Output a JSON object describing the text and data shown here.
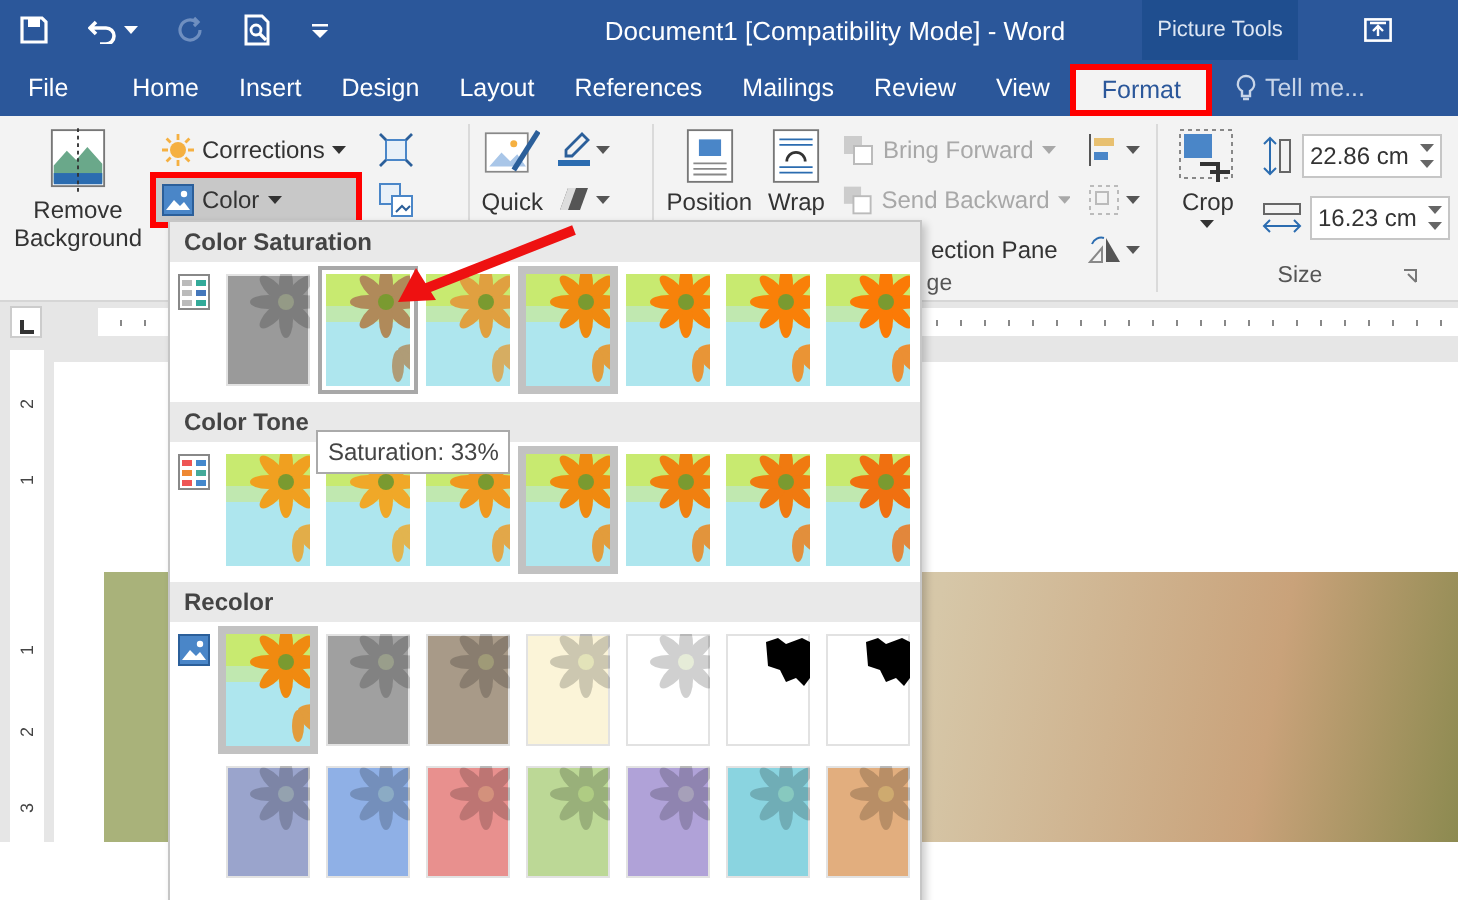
{
  "title_bar": {
    "title": "Document1 [Compatibility Mode] - Word",
    "context_label": "Picture Tools"
  },
  "quick_access": [
    {
      "kind": "save",
      "disabled": false
    },
    {
      "kind": "undo",
      "disabled": false
    },
    {
      "kind": "redo",
      "disabled": true
    },
    {
      "kind": "preview",
      "disabled": false
    },
    {
      "kind": "customize",
      "disabled": false
    }
  ],
  "tabs": [
    {
      "label": "File",
      "selected": false,
      "highlighted": false
    },
    {
      "label": "Home",
      "selected": false,
      "highlighted": false
    },
    {
      "label": "Insert",
      "selected": false,
      "highlighted": false
    },
    {
      "label": "Design",
      "selected": false,
      "highlighted": false
    },
    {
      "label": "Layout",
      "selected": false,
      "highlighted": false
    },
    {
      "label": "References",
      "selected": false,
      "highlighted": false
    },
    {
      "label": "Mailings",
      "selected": false,
      "highlighted": false
    },
    {
      "label": "Review",
      "selected": false,
      "highlighted": false
    },
    {
      "label": "View",
      "selected": false,
      "highlighted": false
    },
    {
      "label": "Format",
      "selected": true,
      "highlighted": true
    }
  ],
  "tell_me": {
    "placeholder": "Tell me..."
  },
  "ribbon": {
    "remove_background": {
      "label": "Remove Background"
    },
    "adjust_buttons": [
      {
        "label": "Corrections",
        "highlighted": false
      },
      {
        "label": "Color",
        "highlighted": true
      }
    ],
    "quick_styles": {
      "label": "Quick"
    },
    "position": {
      "label": "Position"
    },
    "wrap": {
      "label": "Wrap"
    },
    "arrange_buttons": [
      {
        "label": "Bring Forward",
        "disabled": true
      },
      {
        "label": "Send Backward",
        "disabled": true
      },
      {
        "label": "ection Pane",
        "disabled": false
      }
    ],
    "arrange_label": "ge",
    "crop": {
      "label": "Crop"
    },
    "size_fields": [
      {
        "kind": "height",
        "value": "22.86 cm"
      },
      {
        "kind": "width",
        "value": "16.23 cm"
      }
    ],
    "size_label": "Size"
  },
  "color_gallery": {
    "sections": [
      {
        "title": "Color Saturation",
        "kind": "saturation",
        "rows": [
          [
            {
              "kind": "wash",
              "color": "#9a9a9a",
              "selected": false,
              "hovered": false
            },
            {
              "kind": "photo",
              "color": "#b08a5a",
              "selected": false,
              "hovered": true
            },
            {
              "kind": "photo",
              "color": "#e0a040",
              "selected": false,
              "hovered": false
            },
            {
              "kind": "photo",
              "color": "#f08a10",
              "selected": true,
              "hovered": false
            },
            {
              "kind": "photo",
              "color": "#f7820a",
              "selected": false,
              "hovered": false
            },
            {
              "kind": "photo",
              "color": "#f98008",
              "selected": false,
              "hovered": false
            },
            {
              "kind": "photo",
              "color": "#fb7a06",
              "selected": false,
              "hovered": false
            }
          ]
        ]
      },
      {
        "title": "Color Tone",
        "kind": "tone",
        "rows": [
          [
            {
              "kind": "photo",
              "color": "#f0a020",
              "selected": false,
              "hovered": false
            },
            {
              "kind": "photo",
              "color": "#f0a828",
              "selected": false,
              "hovered": false
            },
            {
              "kind": "photo",
              "color": "#f09820",
              "selected": false,
              "hovered": false
            },
            {
              "kind": "photo",
              "color": "#f08a10",
              "selected": true,
              "hovered": false
            },
            {
              "kind": "photo",
              "color": "#f08010",
              "selected": false,
              "hovered": false
            },
            {
              "kind": "photo",
              "color": "#f07a10",
              "selected": false,
              "hovered": false
            },
            {
              "kind": "photo",
              "color": "#f07010",
              "selected": false,
              "hovered": false
            }
          ]
        ]
      },
      {
        "title": "Recolor",
        "kind": "recolor",
        "rows": [
          [
            {
              "kind": "photo",
              "color": "#f08a10",
              "selected": true,
              "hovered": false
            },
            {
              "kind": "wash",
              "color": "#a0a0a0",
              "selected": false,
              "hovered": false
            },
            {
              "kind": "wash",
              "color": "#a89a88",
              "selected": false,
              "hovered": false
            },
            {
              "kind": "wash",
              "color": "#fbf4d8",
              "selected": false,
              "hovered": false
            },
            {
              "kind": "wash",
              "color": "#ffffff",
              "selected": false,
              "hovered": false
            },
            {
              "kind": "blackwhite",
              "color": "#ffffff",
              "selected": false,
              "hovered": false
            },
            {
              "kind": "blackwhite",
              "color": "#ffffff",
              "selected": false,
              "hovered": false
            }
          ],
          [
            {
              "kind": "wash",
              "color": "#9aa4cc",
              "selected": false,
              "hovered": false
            },
            {
              "kind": "wash",
              "color": "#8fb0e6",
              "selected": false,
              "hovered": false
            },
            {
              "kind": "wash",
              "color": "#e8908e",
              "selected": false,
              "hovered": false
            },
            {
              "kind": "wash",
              "color": "#bcd896",
              "selected": false,
              "hovered": false
            },
            {
              "kind": "wash",
              "color": "#b0a2d8",
              "selected": false,
              "hovered": false
            },
            {
              "kind": "wash",
              "color": "#8ad4e0",
              "selected": false,
              "hovered": false
            },
            {
              "kind": "wash",
              "color": "#e2ae7e",
              "selected": false,
              "hovered": false
            }
          ]
        ]
      }
    ]
  },
  "tooltip": "Saturation: 33%",
  "vertical_ruler": [
    "2",
    "1",
    "1",
    "2",
    "3"
  ]
}
